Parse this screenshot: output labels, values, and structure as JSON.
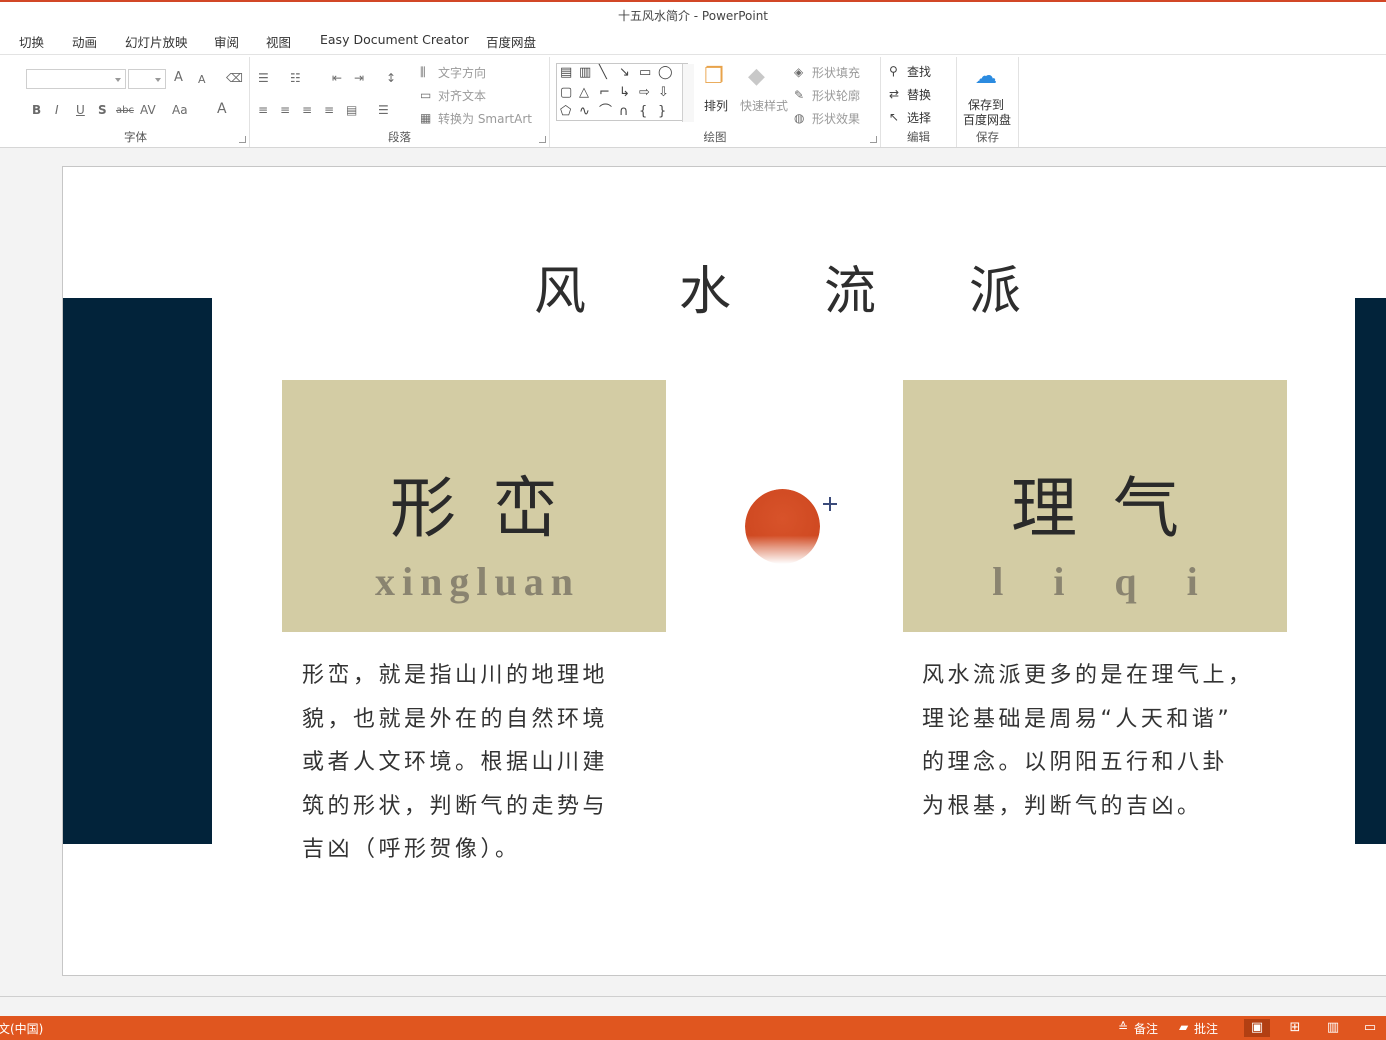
{
  "window": {
    "title": "十五风水简介 - PowerPoint"
  },
  "tabs": [
    "切换",
    "动画",
    "幻灯片放映",
    "审阅",
    "视图",
    "Easy Document Creator",
    "百度网盘"
  ],
  "ribbon": {
    "font": {
      "group_label": "字体",
      "bold": "B",
      "italic": "I",
      "underline": "U",
      "shadow": "S",
      "strike": "abc",
      "spacing": "AV",
      "case": "Aa",
      "grow": "A",
      "shrink": "A",
      "color": "A"
    },
    "paragraph": {
      "group_label": "段落",
      "text_direction": "文字方向",
      "align_text": "对齐文本",
      "convert_smartart": "转换为 SmartArt"
    },
    "drawing": {
      "group_label": "绘图",
      "arrange": "排列",
      "quick_styles": "快速样式",
      "shape_fill": "形状填充",
      "shape_outline": "形状轮廓",
      "shape_effects": "形状效果"
    },
    "editing": {
      "group_label": "编辑",
      "find": "查找",
      "replace": "替换",
      "select": "选择"
    },
    "save": {
      "group_label": "保存",
      "button_line1": "保存到",
      "button_line2": "百度网盘"
    }
  },
  "slide": {
    "title": "风水流派",
    "left_card": {
      "title": "形峦",
      "pinyin": "xingluan"
    },
    "right_card": {
      "title": "理气",
      "pinyin": "liqi"
    },
    "left_text": "形峦，就是指山川的地理地\n貌，也就是外在的自然环境\n或者人文环境。根据山川建\n筑的形状，判断气的走势与\n吉凶（呼形贺像）。",
    "right_text": "风水流派更多的是在理气上，\n理论基础是周易“人天和谐”\n的理念。以阴阳五行和八卦\n为根基，判断气的吉凶。",
    "colors": {
      "band": "#02233a",
      "card": "#d3cca4",
      "sun": "#d04a22"
    }
  },
  "statusbar": {
    "language": "文(中国)",
    "notes": "备注",
    "comments": "批注"
  },
  "theme": {
    "accent": "#e0561f"
  }
}
